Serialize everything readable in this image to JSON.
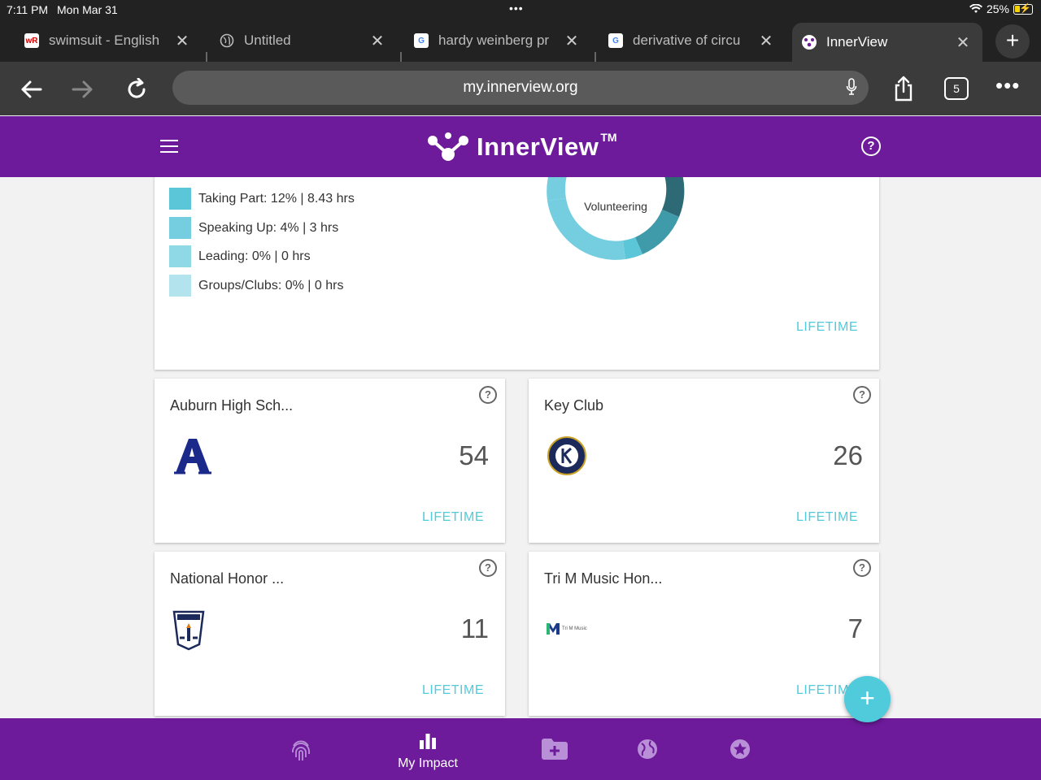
{
  "status_bar": {
    "time": "7:11 PM",
    "date": "Mon Mar 31",
    "dots": "•••",
    "battery": "25%"
  },
  "tabs": [
    {
      "label": "swimsuit - English",
      "favicon": "wordreference-icon"
    },
    {
      "label": "Untitled",
      "favicon": "globe-icon"
    },
    {
      "label": "hardy weinberg pr",
      "favicon": "google-icon"
    },
    {
      "label": "derivative of circu",
      "favicon": "google-icon"
    },
    {
      "label": "InnerView",
      "favicon": "innerview-icon",
      "active": true
    }
  ],
  "address_bar": {
    "url": "my.innerview.org",
    "tab_count": "5"
  },
  "header": {
    "brand": "InnerView",
    "trademark": "TM"
  },
  "impact_card": {
    "legend": [
      {
        "label": "Taking Part: 12% | 8.43 hrs",
        "color": "#5bc6d8"
      },
      {
        "label": "Speaking Up: 4% | 3 hrs",
        "color": "#74cee0"
      },
      {
        "label": "Leading: 0% | 0 hrs",
        "color": "#8fd8e6"
      },
      {
        "label": "Groups/Clubs: 0% | 0 hrs",
        "color": "#b3e4ee"
      }
    ],
    "donut_center": "Volunteering",
    "period": "LIFETIME"
  },
  "org_cards": [
    {
      "title": "Auburn High Sch...",
      "count": "54",
      "period": "LIFETIME",
      "logo": "auburn-a-logo"
    },
    {
      "title": "Key Club",
      "count": "26",
      "period": "LIFETIME",
      "logo": "key-club-logo"
    },
    {
      "title": "National Honor ...",
      "count": "11",
      "period": "LIFETIME",
      "logo": "nhs-logo"
    },
    {
      "title": "Tri M Music Hon...",
      "count": "7",
      "period": "LIFETIME",
      "logo": "tri-m-logo",
      "logo_text": "Tri M Music"
    }
  ],
  "bottom_nav": {
    "active_label": "My Impact"
  },
  "colors": {
    "brand_purple": "#6d1b9b",
    "accent_cyan": "#4fcbdc",
    "browser_dark": "#222222"
  }
}
